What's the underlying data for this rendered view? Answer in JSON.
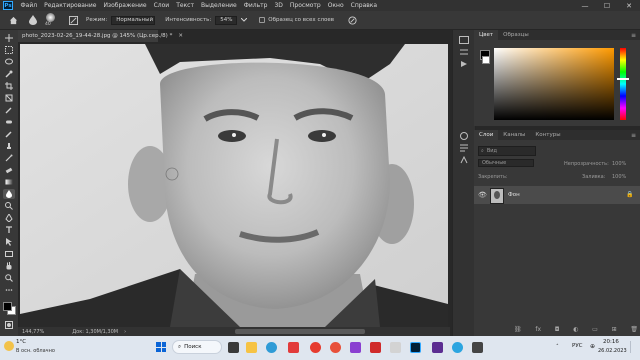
{
  "app": {
    "logo": "Ps"
  },
  "menu": [
    "Файл",
    "Редактирование",
    "Изображение",
    "Слои",
    "Текст",
    "Выделение",
    "Фильтр",
    "3D",
    "Просмотр",
    "Окно",
    "Справка"
  ],
  "window_controls": {
    "minimize": "—",
    "maximize": "☐",
    "close": "✕"
  },
  "options": {
    "brush_size": "40",
    "mode_label": "Режим:",
    "mode_value": "Нормальный",
    "intensity_label": "Интенсивность:",
    "intensity_value": "54%",
    "sample_all_label": "Образец со всех слоев"
  },
  "document": {
    "tab_title": "photo_2023-02-26_19-44-28.jpg @ 145% (Цр.сер./8) *",
    "zoom": "144,77%",
    "doc_info": "Док: 1,30М/1,30М"
  },
  "color_panel": {
    "tabs": [
      "Цвет",
      "Образцы"
    ],
    "accent_hue": "#ff9a00"
  },
  "layers_panel": {
    "tabs": [
      "Слои",
      "Каналы",
      "Контуры"
    ],
    "search_placeholder": "Вид",
    "blend_mode": "Обычные",
    "opacity_label": "Непрозрачность:",
    "opacity_value": "100%",
    "lock_label": "Закрепить:",
    "fill_label": "Заливка:",
    "fill_value": "100%",
    "layer_name": "Фон"
  },
  "taskbar": {
    "weather_temp": "1°C",
    "weather_desc": "В осн. облачно",
    "search_label": "Поиск",
    "language": "РУС",
    "time": "20:16",
    "date": "26.02.2023"
  }
}
